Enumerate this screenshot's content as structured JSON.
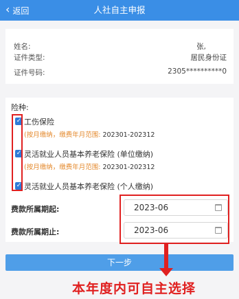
{
  "header": {
    "back_label": "返回",
    "title": "人社自主申报"
  },
  "info": {
    "name_label": "姓名:",
    "name_value": "张,",
    "id_type_label": "证件类型:",
    "id_type_value": "居民身份证",
    "id_no_label": "证件号码:",
    "id_no_value": "2305**********0"
  },
  "form": {
    "risk_title": "险种:",
    "options": [
      {
        "label": "工伤保险",
        "checked": true,
        "note_prefix": "(按月缴纳，缴费年月范围:",
        "note_range": "202301-202312"
      },
      {
        "label": "灵活就业人员基本养老保险 (单位缴纳)",
        "checked": true,
        "note_prefix": "(按月缴纳，缴费年月范围:",
        "note_range": "202301-202312"
      },
      {
        "label": "灵活就业人员基本养老保险 (个人缴纳)",
        "checked": true
      }
    ],
    "period_start_label": "费款所属期起:",
    "period_start_value": "2023-06",
    "period_end_label": "费款所属期止:",
    "period_end_value": "2023-06"
  },
  "next_button": "下一步",
  "annotation": "本年度内可自主选择",
  "colors": {
    "header_bg": "#3a8ee6",
    "button_bg": "#4f9ee8",
    "highlight_red": "#e02020",
    "note_orange": "#e48a2e",
    "checkbox_blue": "#2f7ad6"
  }
}
